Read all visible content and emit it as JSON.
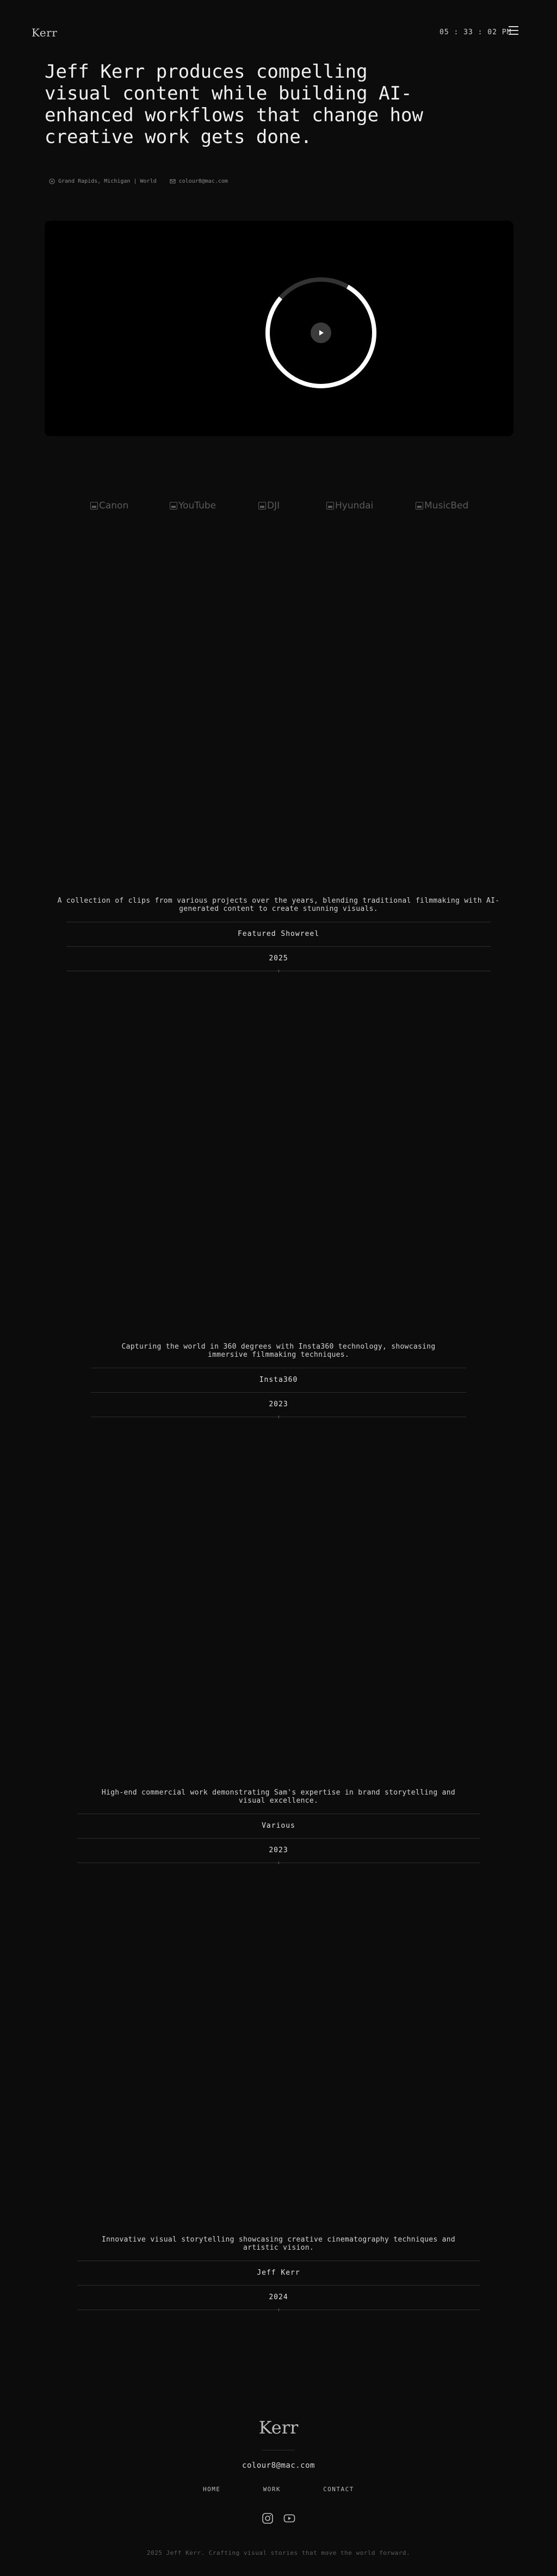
{
  "header": {
    "logo": "Kerr",
    "clock": "05 : 33 : 02 PM"
  },
  "hero": {
    "title": "Jeff Kerr produces compelling visual content while building AI-enhanced workflows that change how creative work gets done.",
    "location": "Grand Rapids, Michigan | World",
    "email": "colour8@mac.com"
  },
  "brands": [
    "Canon",
    "YouTube",
    "DJI",
    "Hyundai",
    "MusicBed"
  ],
  "projects": [
    {
      "description": "A collection of clips from various projects over the years, blending traditional filmmaking with AI-generated content to create stunning visuals.",
      "client": "Featured Showreel",
      "year": "2025"
    },
    {
      "description": "Capturing the world in 360 degrees with Insta360 technology, showcasing immersive filmmaking techniques.",
      "client": "Insta360",
      "year": "2023"
    },
    {
      "description": "High-end commercial work demonstrating Sam's expertise in brand storytelling and visual excellence.",
      "client": "Various",
      "year": "2023"
    },
    {
      "description": "Innovative visual storytelling showcasing creative cinematography techniques and artistic vision.",
      "client": "Jeff Kerr",
      "year": "2024"
    }
  ],
  "footer": {
    "logo": "Kerr",
    "email": "colour8@mac.com",
    "nav": [
      "HOME",
      "WORK",
      "CONTACT"
    ],
    "copyright": "2025 Jeff Kerr. Crafting visual stories that move the world forward."
  },
  "video": {
    "progress": 0.78
  },
  "colors": {
    "background": "#0c0c0c",
    "video_bg": "#000000",
    "ring_track": "#333333",
    "ring_progress": "#ffffff"
  }
}
